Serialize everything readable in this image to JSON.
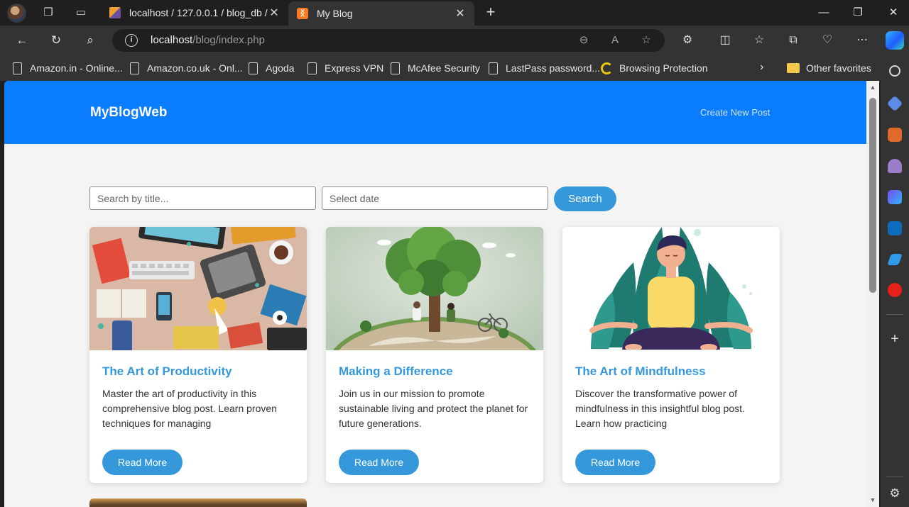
{
  "browser": {
    "tabs": [
      {
        "label": "localhost / 127.0.0.1 / blog_db / ",
        "active": false
      },
      {
        "label": "My Blog",
        "active": true
      }
    ],
    "url_host": "localhost",
    "url_path": "/blog/index.php",
    "favorites": [
      "Amazon.in - Online...",
      "Amazon.co.uk - Onl...",
      "Agoda",
      "Express VPN",
      "McAfee Security",
      "LastPass password...",
      "Browsing Protection"
    ],
    "other_favorites": "Other favorites"
  },
  "site": {
    "brand": "MyBlogWeb",
    "create_link": "Create New Post",
    "accent_color": "#0a7cff"
  },
  "search": {
    "title_placeholder": "Search by title...",
    "date_placeholder": "Select date",
    "button": "Search"
  },
  "posts": [
    {
      "title": "The Art of Productivity",
      "excerpt": "Master the art of productivity in this comprehensive blog post. Learn proven techniques for managing",
      "button": "Read More",
      "image": "flat-lay-desk-illustration"
    },
    {
      "title": "Making a Difference",
      "excerpt": "Join us in our mission to promote sustainable living and protect the planet for future generations.",
      "button": "Read More",
      "image": "tree-on-globe-illustration"
    },
    {
      "title": "The Art of Mindfulness",
      "excerpt": "Discover the transformative power of mindfulness in this insightful blog post. Learn how practicing",
      "button": "Read More",
      "image": "meditation-illustration"
    }
  ]
}
